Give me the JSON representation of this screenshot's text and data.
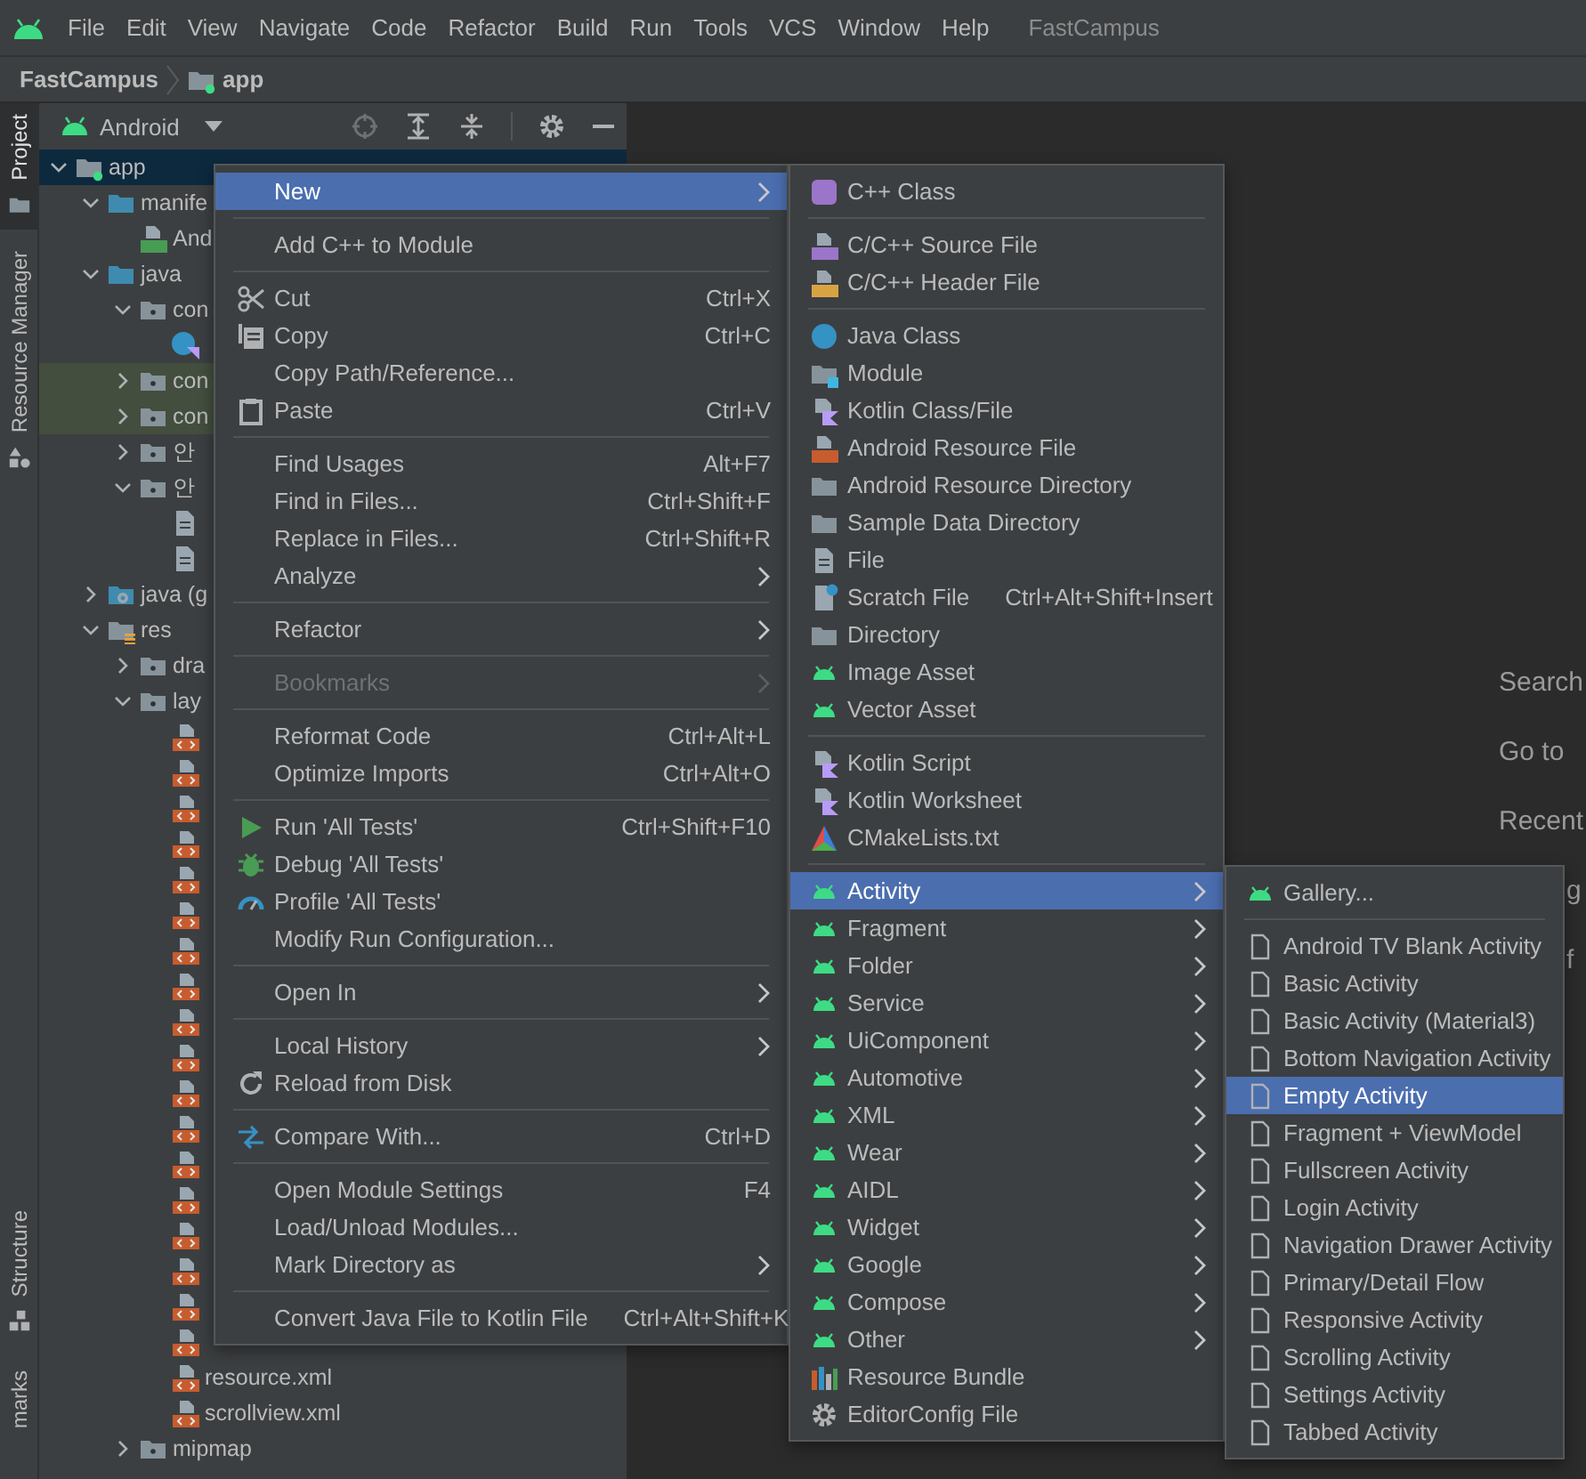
{
  "menu_bar": {
    "items": [
      "File",
      "Edit",
      "View",
      "Navigate",
      "Code",
      "Refactor",
      "Build",
      "Run",
      "Tools",
      "VCS",
      "Window",
      "Help"
    ],
    "project_name": "FastCampus"
  },
  "breadcrumb": {
    "project": "FastCampus",
    "module": "app"
  },
  "tool_strip": {
    "top": [
      {
        "label": "Project",
        "kind": "folder",
        "selected": true
      },
      {
        "label": "Resource Manager",
        "kind": "shapes",
        "selected": false
      }
    ],
    "bottom": [
      {
        "label": "Structure",
        "kind": "structure",
        "selected": false
      },
      {
        "label": "marks",
        "selected": false
      }
    ]
  },
  "project_panel": {
    "view": "Android",
    "tree": [
      {
        "label": "app",
        "kind": "module",
        "expanded": true,
        "selected": true,
        "highlighted": false,
        "children": [
          {
            "label": "manife",
            "kind": "srcfolder",
            "expanded": true,
            "selected": false,
            "highlighted": false,
            "children": [
              {
                "label": "And",
                "kind": "manifest",
                "selected": false,
                "highlighted": false
              }
            ]
          },
          {
            "label": "java",
            "kind": "srcfolder",
            "expanded": true,
            "selected": false,
            "highlighted": false,
            "children": [
              {
                "label": "con",
                "kind": "package",
                "expanded": true,
                "selected": false,
                "highlighted": false,
                "children": [
                  {
                    "kind": "kclass",
                    "selected": false,
                    "highlighted": false
                  }
                ]
              },
              {
                "label": "con",
                "kind": "package",
                "expanded": false,
                "selected": false,
                "highlighted": true
              },
              {
                "label": "con",
                "kind": "package",
                "expanded": false,
                "selected": false,
                "highlighted": true
              },
              {
                "label": "안",
                "kind": "package",
                "expanded": false,
                "selected": false,
                "highlighted": false
              },
              {
                "label": "안",
                "kind": "package",
                "expanded": true,
                "selected": false,
                "highlighted": false,
                "children": [
                  {
                    "kind": "file",
                    "selected": false,
                    "highlighted": false
                  },
                  {
                    "kind": "file",
                    "selected": false,
                    "highlighted": false
                  }
                ]
              }
            ]
          },
          {
            "label": "java (g",
            "kind": "generated",
            "expanded": false,
            "selected": false,
            "highlighted": false
          },
          {
            "label": "res",
            "kind": "res",
            "expanded": true,
            "selected": false,
            "highlighted": false,
            "children": [
              {
                "label": "dra",
                "kind": "package",
                "expanded": false,
                "selected": false,
                "highlighted": false
              },
              {
                "label": "lay",
                "kind": "package",
                "expanded": true,
                "selected": false,
                "highlighted": false,
                "children": [
                  {
                    "kind": "xml",
                    "selected": false,
                    "highlighted": false
                  },
                  {
                    "kind": "xml",
                    "selected": false,
                    "highlighted": false
                  },
                  {
                    "kind": "xml",
                    "selected": false,
                    "highlighted": false
                  },
                  {
                    "kind": "xml",
                    "selected": false,
                    "highlighted": false
                  },
                  {
                    "kind": "xml",
                    "selected": false,
                    "highlighted": false
                  },
                  {
                    "kind": "xml",
                    "selected": false,
                    "highlighted": false
                  },
                  {
                    "kind": "xml",
                    "selected": false,
                    "highlighted": false
                  },
                  {
                    "kind": "xml",
                    "selected": false,
                    "highlighted": false
                  },
                  {
                    "kind": "xml",
                    "selected": false,
                    "highlighted": false
                  },
                  {
                    "kind": "xml",
                    "selected": false,
                    "highlighted": false
                  },
                  {
                    "kind": "xml",
                    "selected": false,
                    "highlighted": false
                  },
                  {
                    "kind": "xml",
                    "selected": false,
                    "highlighted": false
                  },
                  {
                    "kind": "xml",
                    "selected": false,
                    "highlighted": false
                  },
                  {
                    "kind": "xml",
                    "selected": false,
                    "highlighted": false
                  },
                  {
                    "kind": "xml",
                    "selected": false,
                    "highlighted": false
                  },
                  {
                    "kind": "xml",
                    "selected": false,
                    "highlighted": false
                  },
                  {
                    "kind": "xml",
                    "selected": false,
                    "highlighted": false
                  },
                  {
                    "kind": "xml",
                    "selected": false,
                    "highlighted": false
                  },
                  {
                    "label": "resource.xml",
                    "kind": "xml",
                    "selected": false,
                    "highlighted": false
                  },
                  {
                    "label": "scrollview.xml",
                    "kind": "xml",
                    "selected": false,
                    "highlighted": false
                  }
                ]
              },
              {
                "label": "mipmap",
                "kind": "package",
                "expanded": false,
                "selected": false,
                "highlighted": false
              }
            ]
          }
        ]
      }
    ]
  },
  "context_menu": {
    "items": [
      {
        "kind": "plain",
        "label": "New",
        "submenu": true,
        "disabled": false,
        "selected": true
      },
      {
        "kind": "separator"
      },
      {
        "kind": "plain",
        "label": "Add C++ to Module",
        "submenu": false,
        "disabled": false,
        "selected": false
      },
      {
        "kind": "separator"
      },
      {
        "kind": "scissors",
        "label": "Cut",
        "shortcut": "Ctrl+X",
        "submenu": false,
        "disabled": false,
        "selected": false
      },
      {
        "kind": "copy",
        "label": "Copy",
        "shortcut": "Ctrl+C",
        "submenu": false,
        "disabled": false,
        "selected": false
      },
      {
        "kind": "plain",
        "label": "Copy Path/Reference...",
        "submenu": false,
        "disabled": false,
        "selected": false
      },
      {
        "kind": "paste",
        "label": "Paste",
        "shortcut": "Ctrl+V",
        "submenu": false,
        "disabled": false,
        "selected": false
      },
      {
        "kind": "separator"
      },
      {
        "kind": "plain",
        "label": "Find Usages",
        "shortcut": "Alt+F7",
        "submenu": false,
        "disabled": false,
        "selected": false
      },
      {
        "kind": "plain",
        "label": "Find in Files...",
        "shortcut": "Ctrl+Shift+F",
        "submenu": false,
        "disabled": false,
        "selected": false
      },
      {
        "kind": "plain",
        "label": "Replace in Files...",
        "shortcut": "Ctrl+Shift+R",
        "submenu": false,
        "disabled": false,
        "selected": false
      },
      {
        "kind": "plain",
        "label": "Analyze",
        "submenu": true,
        "disabled": false,
        "selected": false
      },
      {
        "kind": "separator"
      },
      {
        "kind": "plain",
        "label": "Refactor",
        "submenu": true,
        "disabled": false,
        "selected": false
      },
      {
        "kind": "separator"
      },
      {
        "kind": "plain",
        "label": "Bookmarks",
        "submenu": true,
        "disabled": true,
        "selected": false
      },
      {
        "kind": "separator"
      },
      {
        "kind": "plain",
        "label": "Reformat Code",
        "shortcut": "Ctrl+Alt+L",
        "submenu": false,
        "disabled": false,
        "selected": false
      },
      {
        "kind": "plain",
        "label": "Optimize Imports",
        "shortcut": "Ctrl+Alt+O",
        "submenu": false,
        "disabled": false,
        "selected": false
      },
      {
        "kind": "separator"
      },
      {
        "kind": "run",
        "label": "Run 'All Tests'",
        "shortcut": "Ctrl+Shift+F10",
        "submenu": false,
        "disabled": false,
        "selected": false
      },
      {
        "kind": "debug",
        "label": "Debug 'All Tests'",
        "submenu": false,
        "disabled": false,
        "selected": false
      },
      {
        "kind": "profile",
        "label": "Profile 'All Tests'",
        "submenu": false,
        "disabled": false,
        "selected": false
      },
      {
        "kind": "plain",
        "label": "Modify Run Configuration...",
        "submenu": false,
        "disabled": false,
        "selected": false
      },
      {
        "kind": "separator"
      },
      {
        "kind": "plain",
        "label": "Open In",
        "submenu": true,
        "disabled": false,
        "selected": false
      },
      {
        "kind": "separator"
      },
      {
        "kind": "plain",
        "label": "Local History",
        "submenu": true,
        "disabled": false,
        "selected": false
      },
      {
        "kind": "reload",
        "label": "Reload from Disk",
        "submenu": false,
        "disabled": false,
        "selected": false
      },
      {
        "kind": "separator"
      },
      {
        "kind": "compare",
        "label": "Compare With...",
        "shortcut": "Ctrl+D",
        "submenu": false,
        "disabled": false,
        "selected": false
      },
      {
        "kind": "separator"
      },
      {
        "kind": "plain",
        "label": "Open Module Settings",
        "shortcut": "F4",
        "submenu": false,
        "disabled": false,
        "selected": false
      },
      {
        "kind": "plain",
        "label": "Load/Unload Modules...",
        "submenu": false,
        "disabled": false,
        "selected": false
      },
      {
        "kind": "plain",
        "label": "Mark Directory as",
        "submenu": true,
        "disabled": false,
        "selected": false
      },
      {
        "kind": "separator"
      },
      {
        "kind": "plain",
        "label": "Convert Java File to Kotlin File",
        "shortcut": "Ctrl+Alt+Shift+K",
        "submenu": false,
        "disabled": false,
        "selected": false
      }
    ]
  },
  "new_submenu": {
    "items": [
      {
        "kind": "cppclass",
        "label": "C++ Class",
        "submenu": false,
        "disabled": false,
        "selected": false
      },
      {
        "kind": "separator"
      },
      {
        "kind": "cppsource",
        "label": "C/C++ Source File",
        "submenu": false,
        "disabled": false,
        "selected": false
      },
      {
        "kind": "cppheader",
        "label": "C/C++ Header File",
        "submenu": false,
        "disabled": false,
        "selected": false
      },
      {
        "kind": "separator"
      },
      {
        "kind": "javaclass",
        "label": "Java Class",
        "submenu": false,
        "disabled": false,
        "selected": false
      },
      {
        "kind": "modulebox",
        "label": "Module",
        "submenu": false,
        "disabled": false,
        "selected": false
      },
      {
        "kind": "kotlin",
        "label": "Kotlin Class/File",
        "submenu": false,
        "disabled": false,
        "selected": false
      },
      {
        "kind": "resfile",
        "label": "Android Resource File",
        "submenu": false,
        "disabled": false,
        "selected": false
      },
      {
        "kind": "folder",
        "label": "Android Resource Directory",
        "submenu": false,
        "disabled": false,
        "selected": false
      },
      {
        "kind": "folder",
        "label": "Sample Data Directory",
        "submenu": false,
        "disabled": false,
        "selected": false
      },
      {
        "kind": "file",
        "label": "File",
        "submenu": false,
        "disabled": false,
        "selected": false
      },
      {
        "kind": "scratch",
        "label": "Scratch File",
        "shortcut": "Ctrl+Alt+Shift+Insert",
        "submenu": false,
        "disabled": false,
        "selected": false
      },
      {
        "kind": "folder",
        "label": "Directory",
        "submenu": false,
        "disabled": false,
        "selected": false
      },
      {
        "kind": "android",
        "label": "Image Asset",
        "submenu": false,
        "disabled": false,
        "selected": false
      },
      {
        "kind": "android",
        "label": "Vector Asset",
        "submenu": false,
        "disabled": false,
        "selected": false
      },
      {
        "kind": "separator"
      },
      {
        "kind": "kotlin",
        "label": "Kotlin Script",
        "submenu": false,
        "disabled": false,
        "selected": false
      },
      {
        "kind": "kotlin",
        "label": "Kotlin Worksheet",
        "submenu": false,
        "disabled": false,
        "selected": false
      },
      {
        "kind": "cmake",
        "label": "CMakeLists.txt",
        "submenu": false,
        "disabled": false,
        "selected": false
      },
      {
        "kind": "separator"
      },
      {
        "kind": "android",
        "label": "Activity",
        "submenu": true,
        "disabled": false,
        "selected": true
      },
      {
        "kind": "android",
        "label": "Fragment",
        "submenu": true,
        "disabled": false,
        "selected": false
      },
      {
        "kind": "android",
        "label": "Folder",
        "submenu": true,
        "disabled": false,
        "selected": false
      },
      {
        "kind": "android",
        "label": "Service",
        "submenu": true,
        "disabled": false,
        "selected": false
      },
      {
        "kind": "android",
        "label": "UiComponent",
        "submenu": true,
        "disabled": false,
        "selected": false
      },
      {
        "kind": "android",
        "label": "Automotive",
        "submenu": true,
        "disabled": false,
        "selected": false
      },
      {
        "kind": "android",
        "label": "XML",
        "submenu": true,
        "disabled": false,
        "selected": false
      },
      {
        "kind": "android",
        "label": "Wear",
        "submenu": true,
        "disabled": false,
        "selected": false
      },
      {
        "kind": "android",
        "label": "AIDL",
        "submenu": true,
        "disabled": false,
        "selected": false
      },
      {
        "kind": "android",
        "label": "Widget",
        "submenu": true,
        "disabled": false,
        "selected": false
      },
      {
        "kind": "android",
        "label": "Google",
        "submenu": true,
        "disabled": false,
        "selected": false
      },
      {
        "kind": "android",
        "label": "Compose",
        "submenu": true,
        "disabled": false,
        "selected": false
      },
      {
        "kind": "android",
        "label": "Other",
        "submenu": true,
        "disabled": false,
        "selected": false
      },
      {
        "kind": "bundle",
        "label": "Resource Bundle",
        "submenu": false,
        "disabled": false,
        "selected": false
      },
      {
        "kind": "gear",
        "label": "EditorConfig File",
        "submenu": false,
        "disabled": false,
        "selected": false
      }
    ]
  },
  "activity_submenu": {
    "items": [
      {
        "kind": "android",
        "label": "Gallery...",
        "submenu": false,
        "disabled": false,
        "selected": false
      },
      {
        "kind": "separator"
      },
      {
        "kind": "document",
        "label": "Android TV Blank Activity",
        "submenu": false,
        "disabled": false,
        "selected": false
      },
      {
        "kind": "document",
        "label": "Basic Activity",
        "submenu": false,
        "disabled": false,
        "selected": false
      },
      {
        "kind": "document",
        "label": "Basic Activity (Material3)",
        "submenu": false,
        "disabled": false,
        "selected": false
      },
      {
        "kind": "document",
        "label": "Bottom Navigation Activity",
        "submenu": false,
        "disabled": false,
        "selected": false
      },
      {
        "kind": "document",
        "label": "Empty Activity",
        "submenu": false,
        "disabled": false,
        "selected": true
      },
      {
        "kind": "document",
        "label": "Fragment + ViewModel",
        "submenu": false,
        "disabled": false,
        "selected": false
      },
      {
        "kind": "document",
        "label": "Fullscreen Activity",
        "submenu": false,
        "disabled": false,
        "selected": false
      },
      {
        "kind": "document",
        "label": "Login Activity",
        "submenu": false,
        "disabled": false,
        "selected": false
      },
      {
        "kind": "document",
        "label": "Navigation Drawer Activity",
        "submenu": false,
        "disabled": false,
        "selected": false
      },
      {
        "kind": "document",
        "label": "Primary/Detail Flow",
        "submenu": false,
        "disabled": false,
        "selected": false
      },
      {
        "kind": "document",
        "label": "Responsive Activity",
        "submenu": false,
        "disabled": false,
        "selected": false
      },
      {
        "kind": "document",
        "label": "Scrolling Activity",
        "submenu": false,
        "disabled": false,
        "selected": false
      },
      {
        "kind": "document",
        "label": "Settings Activity",
        "submenu": false,
        "disabled": false,
        "selected": false
      },
      {
        "kind": "document",
        "label": "Tabbed Activity",
        "submenu": false,
        "disabled": false,
        "selected": false
      }
    ]
  },
  "editor": {
    "hints": [
      "Search",
      "Go to",
      "Recent"
    ],
    "clipped_hints": [
      "g",
      "f"
    ]
  }
}
